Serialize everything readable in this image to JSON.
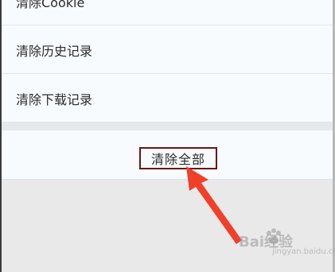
{
  "menu": {
    "items": [
      {
        "label": "清除Cookie"
      },
      {
        "label": "清除历史记录"
      },
      {
        "label": "清除下载记录"
      }
    ]
  },
  "clear_all": {
    "label": "清除全部"
  },
  "watermark": {
    "brand": "Bai经验",
    "sub": "jingyan.baidu.com"
  },
  "colors": {
    "highlight_box": "#6b1414",
    "arrow": "#f0402a"
  }
}
